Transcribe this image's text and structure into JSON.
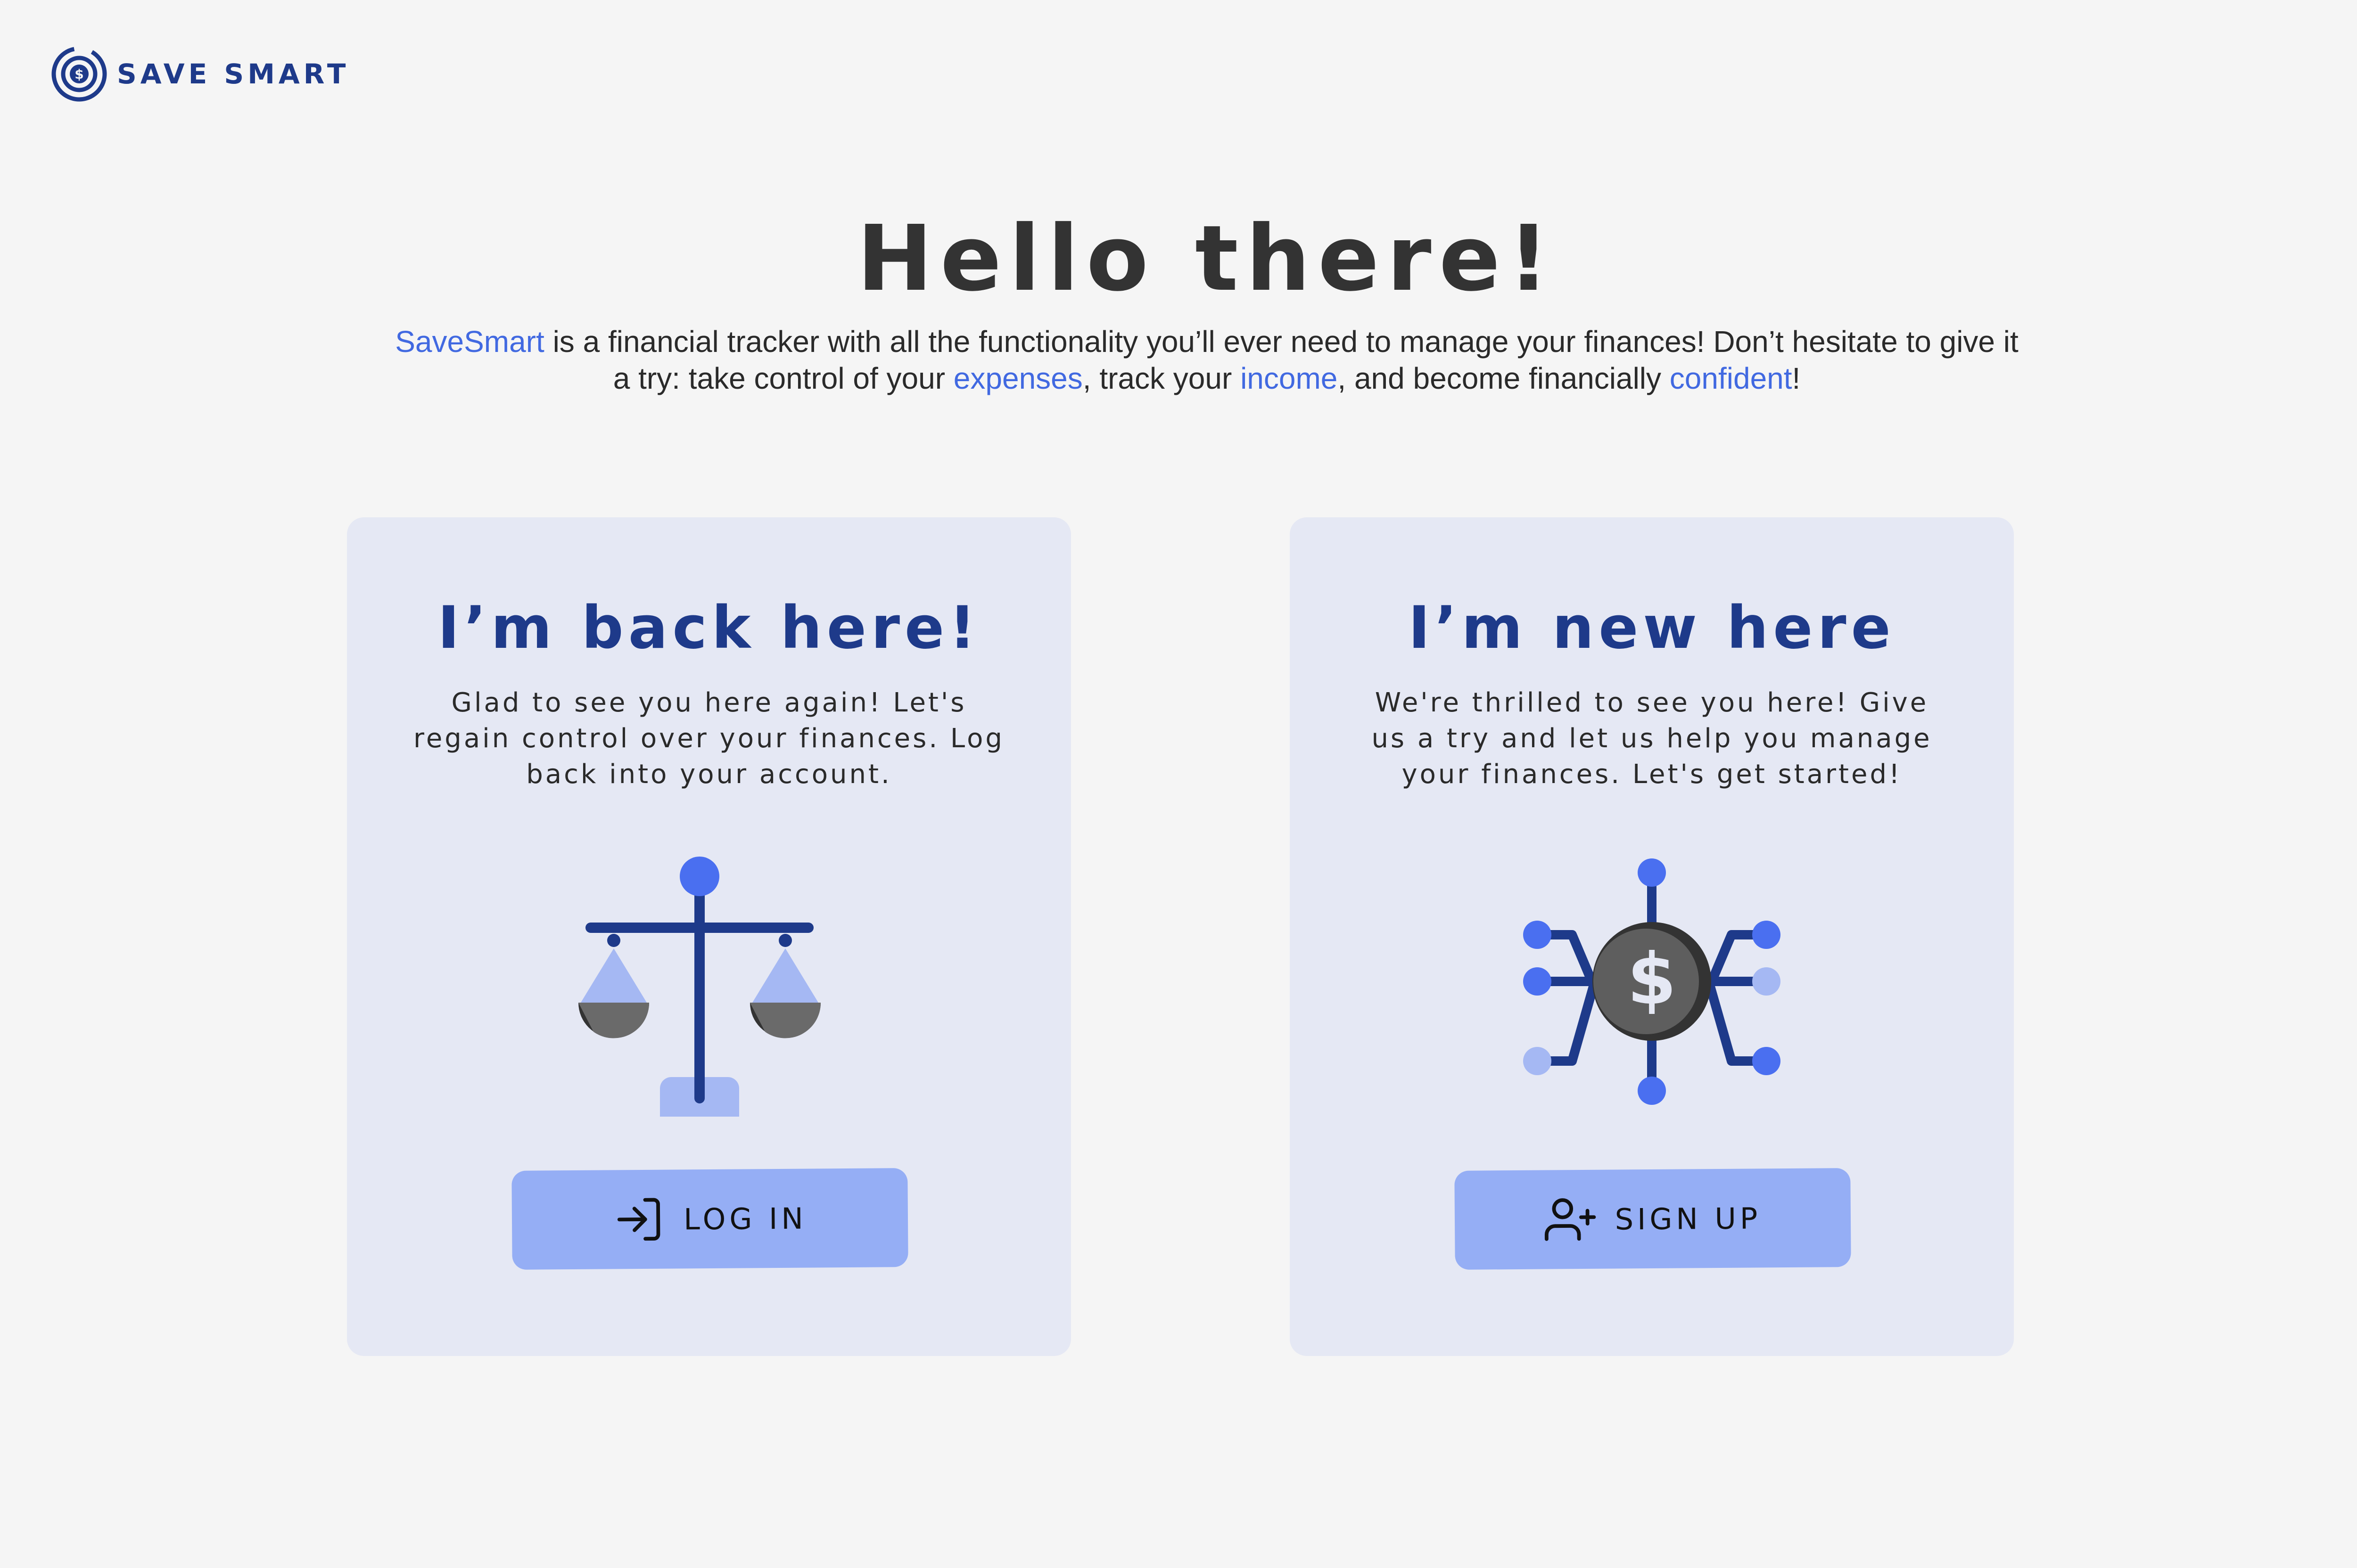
{
  "brand": {
    "name": "SAVE SMART",
    "logo_icon": "dollar-target-icon",
    "color": "#1e3a8a"
  },
  "hero": {
    "title": "Hello there!",
    "text": {
      "brand": "SaveSmart",
      "part1": " is a financial tracker with all the functionality you’ll ever need to manage your finances! Don’t hesitate to give it a try: take control of your ",
      "expenses": "expenses",
      "part2": ", track your ",
      "income": "income",
      "part3": ", and become financially ",
      "confident": "confident",
      "part4": "!"
    }
  },
  "cards": {
    "login": {
      "title": "I’m back here!",
      "text": "Glad to see you here again! Let's regain control over your finances. Log back into your account.",
      "illustration": "balance-scale-icon",
      "button": {
        "label": "LOG IN",
        "icon": "log-in-icon"
      }
    },
    "signup": {
      "title": "I’m new here",
      "text": "We're thrilled to see you here! Give us a try and let us help you manage your finances. Let's get started!",
      "illustration": "dollar-network-icon",
      "button": {
        "label": "SIGN UP",
        "icon": "user-plus-icon"
      }
    }
  },
  "colors": {
    "background": "#f5f5f5",
    "card": "#e5e8f4",
    "primary": "#1e3a8a",
    "accent": "#4169e1",
    "button": "#95aef5",
    "light_accent": "#a5b8f3"
  }
}
